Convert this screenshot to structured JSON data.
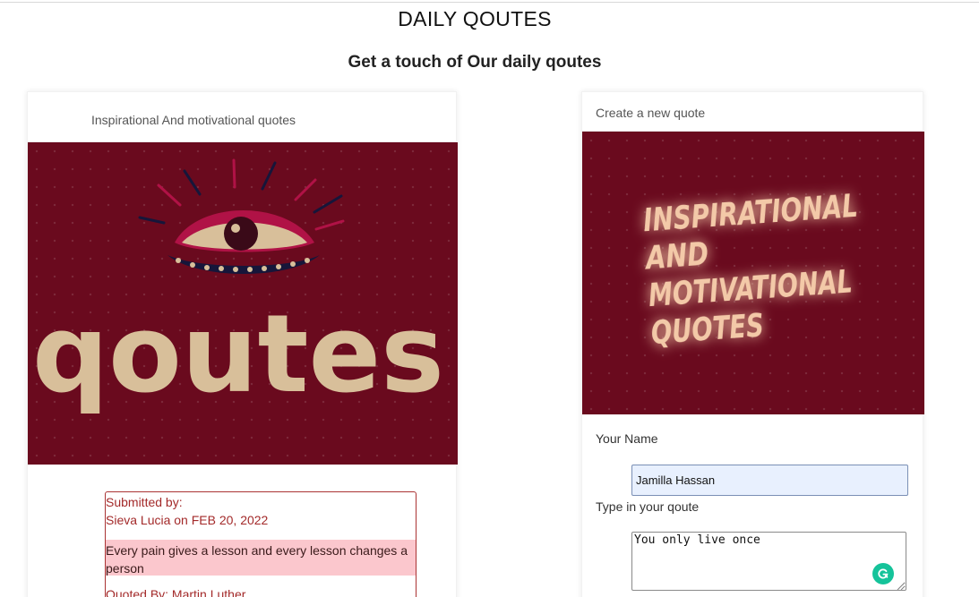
{
  "header": {
    "title": "DAILY QOUTES",
    "subtitle": "Get a touch of Our daily qoutes"
  },
  "left_card": {
    "header": "Inspirational And motivational quotes",
    "image_word": "qoutes",
    "quote": {
      "submitted_label": "Submitted by:",
      "author_line": "Sieva Lucia on FEB 20, 2022",
      "text": "Every pain gives a lesson and every lesson changes a person",
      "quoted_by": "Quoted By: Martin Luther"
    }
  },
  "right_card": {
    "header": "Create a new quote",
    "image_lines": [
      "INSPIRATIONAL",
      "AND",
      "MOTIVATIONAL",
      "QUOTES"
    ],
    "form": {
      "name_label": "Your Name",
      "name_value": "Jamilla Hassan",
      "quote_label": "Type in your qoute",
      "quote_value": "You only live once"
    }
  },
  "colors": {
    "image_background": "#6a0a1e",
    "image_text": "#d8bf9a",
    "eye_accent": "#b01246",
    "glow_text": "#f3c9a8",
    "quote_border": "#aa3333",
    "quote_text": "#a32a2a",
    "quote_highlight": "#fbc7cd",
    "grammar_icon": "#15c39a"
  },
  "icons": {
    "grammar_assistant": "grammarly-g-icon",
    "textarea_resize": "resize-grip-icon"
  }
}
